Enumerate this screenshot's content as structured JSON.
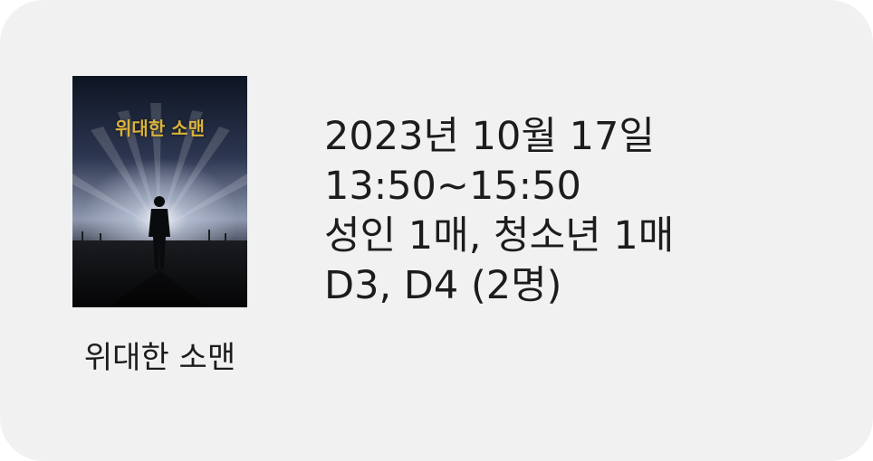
{
  "movie": {
    "title": "위대한 소맨",
    "poster_title": "위대한 소맨",
    "caption": "위대한 소맨"
  },
  "booking": {
    "date": "2023년 10월 17일",
    "time": "13:50~15:50",
    "tickets": "성인 1매, 청소년 1매",
    "seats": "D3, D4 (2명)"
  },
  "colors": {
    "card_background": "#f1f1f1",
    "text": "#1c1c1c",
    "poster_title": "#d9b23a"
  }
}
